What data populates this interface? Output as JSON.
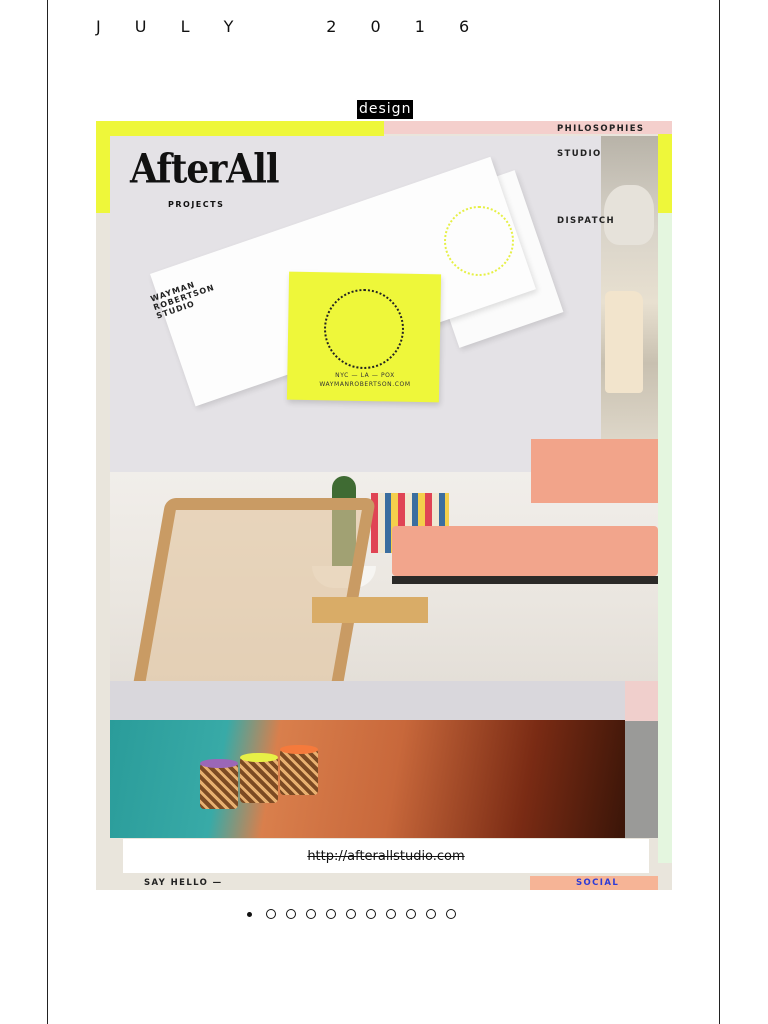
{
  "header": {
    "date": "J U L Y    2 0 1 6",
    "category": "design"
  },
  "screenshot": {
    "brand": "AfterAll",
    "brand_sub": "PROJECTS",
    "nav": {
      "philosophies": "PHILOSOPHIES",
      "studio": "STUDIO",
      "dispatch": "DISPATCH",
      "say_hello": "SAY HELLO —",
      "social": "SOCIAL"
    },
    "stationery": {
      "envelope_stamp": "WAYMAN\nROBERTSON\nSTUDIO",
      "card_lines": "NYC — LA — POX\nWAYMANROBERTSON.COM"
    },
    "url": "http://afterallstudio.com"
  },
  "pagination": {
    "total": 11,
    "active_index": 0
  },
  "colors": {
    "accent_yellow": "#eef73a",
    "accent_pink": "#f4cfcc",
    "accent_salmon": "#f6b496",
    "social_blue": "#2d3bd6"
  }
}
